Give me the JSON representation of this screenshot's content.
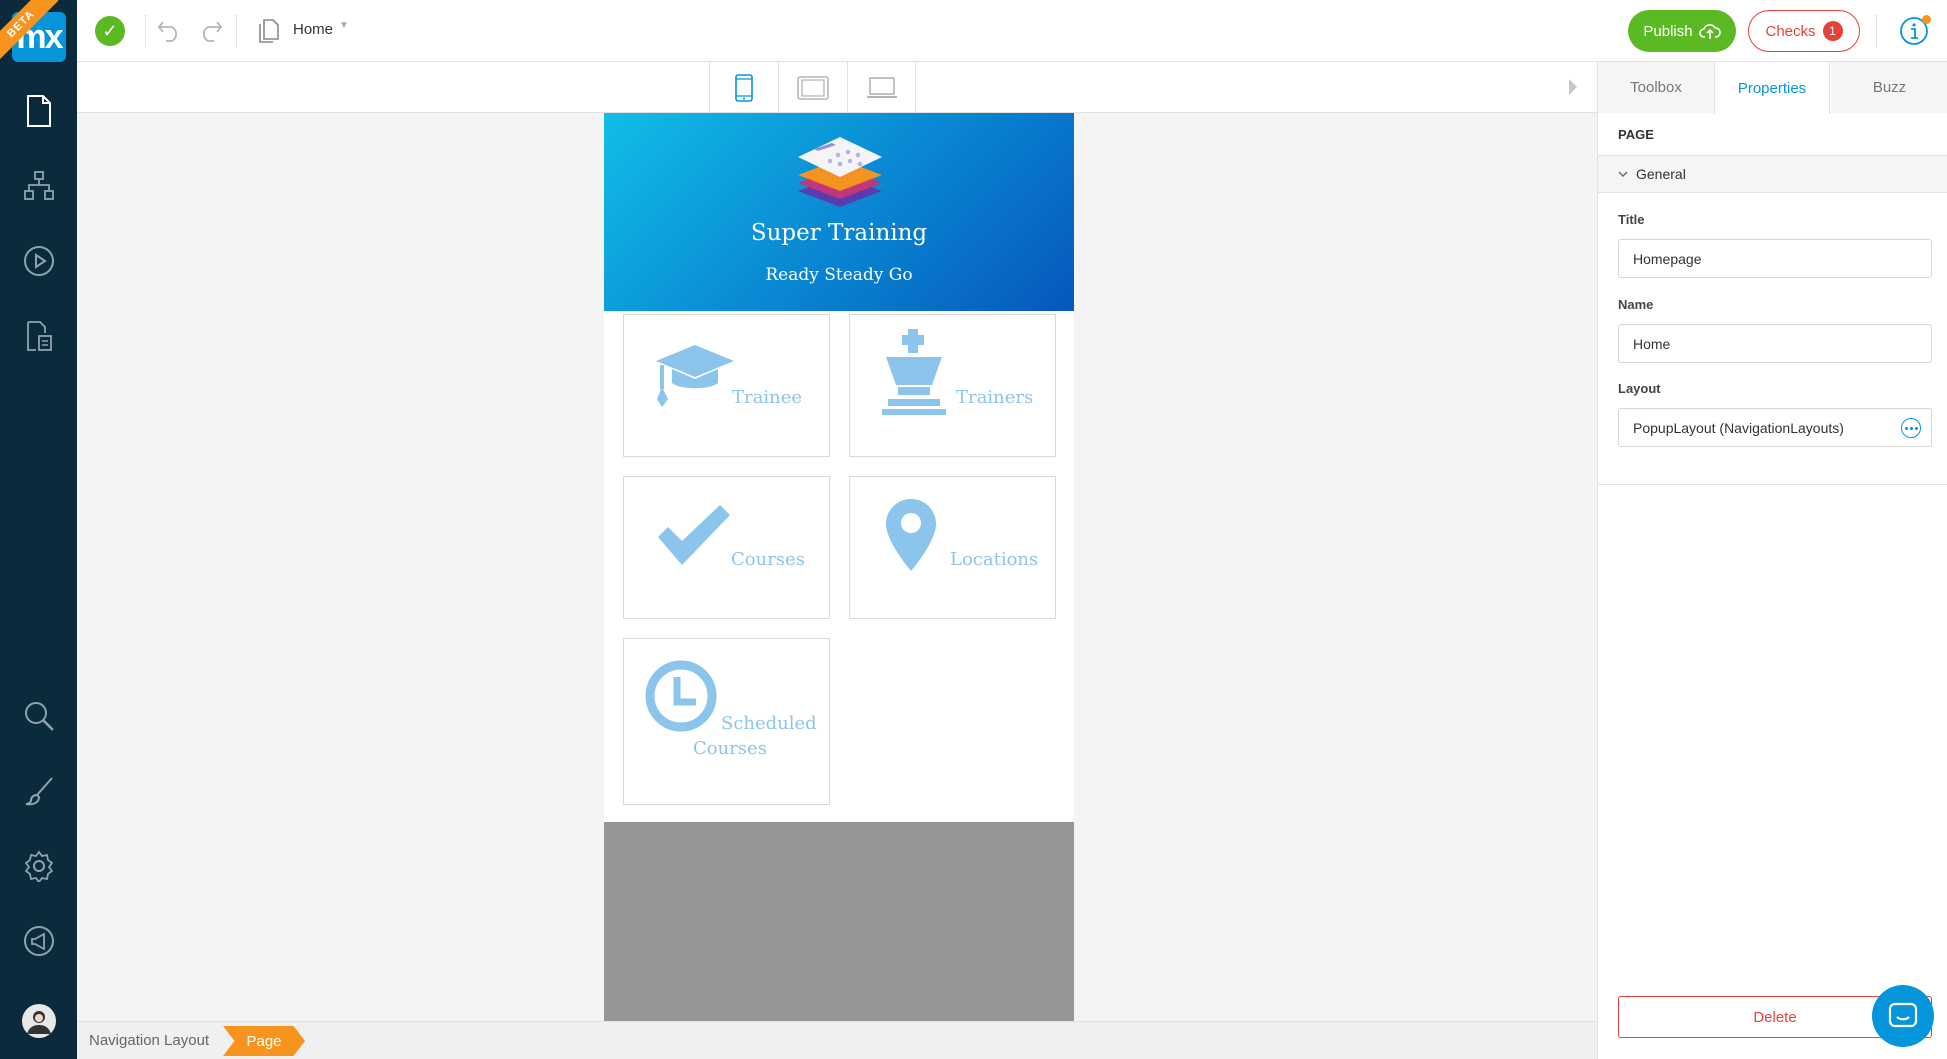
{
  "app": {
    "logo_text": "mx",
    "beta_label": "BETA"
  },
  "toolbar": {
    "document_name": "Home",
    "publish_label": "Publish",
    "checks_label": "Checks",
    "checks_count": "1"
  },
  "left_nav": {
    "items": [
      "page-icon",
      "domain-model-icon",
      "run-icon",
      "app-explorer-icon"
    ],
    "bottom_items": [
      "search-icon",
      "brush-icon",
      "gear-icon",
      "megaphone-icon",
      "user-avatar"
    ]
  },
  "device_tabs": [
    "phone",
    "tablet",
    "desktop"
  ],
  "phone_preview": {
    "app_title": "Super Training",
    "app_subtitle": "Ready Steady Go",
    "tiles": [
      {
        "label": "Trainee",
        "icon": "graduation-cap-icon"
      },
      {
        "label": "Trainers",
        "icon": "chess-king-icon"
      },
      {
        "label": "Courses",
        "icon": "checkmark-icon"
      },
      {
        "label": "Locations",
        "icon": "map-pin-icon"
      },
      {
        "label_line1": "Scheduled",
        "label_line2": "Courses",
        "icon": "clock-icon"
      }
    ]
  },
  "right_panel": {
    "tabs": [
      "Toolbox",
      "Properties",
      "Buzz"
    ],
    "active_tab": "Properties",
    "section_title": "PAGE",
    "group_title": "General",
    "fields": {
      "title_label": "Title",
      "title_value": "Homepage",
      "name_label": "Name",
      "name_value": "Home",
      "layout_label": "Layout",
      "layout_value": "PopupLayout (NavigationLayouts)"
    },
    "delete_label": "Delete"
  },
  "breadcrumb": {
    "items": [
      "Navigation Layout",
      "Page"
    ]
  },
  "colors": {
    "sidebar": "#0b2a3b",
    "accent": "#0595db",
    "success": "#5bb923",
    "danger": "#e5423c",
    "breadcrumb_active": "#f7941d",
    "tile_text": "#8cc5ec"
  }
}
